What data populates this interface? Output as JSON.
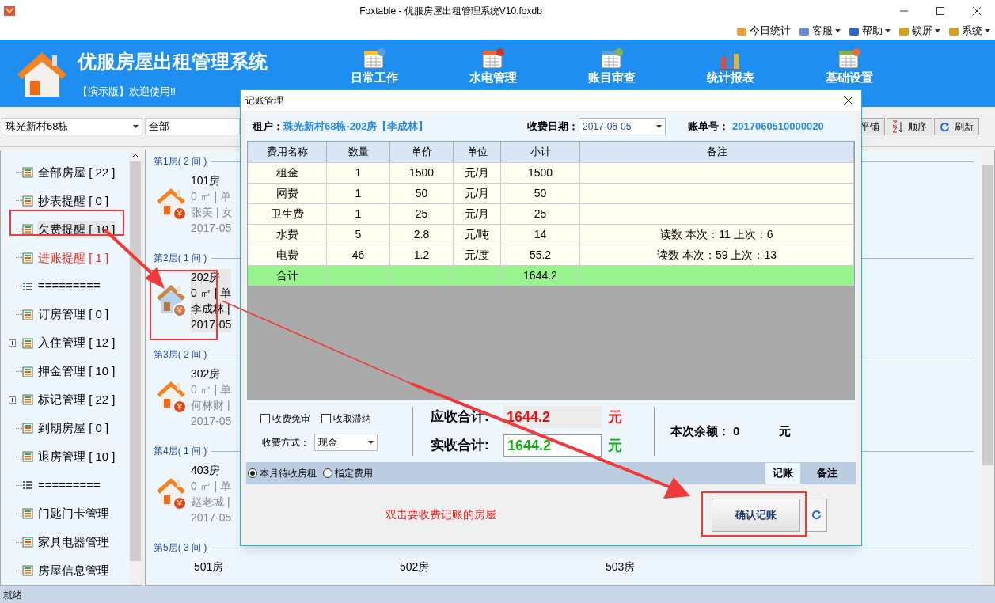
{
  "window": {
    "title": "Foxtable - 优服房屋出租管理系统V10.foxdb"
  },
  "menu": [
    {
      "label": "今日统计",
      "dropdown": false
    },
    {
      "label": "客服",
      "dropdown": true
    },
    {
      "label": "帮助",
      "dropdown": true
    },
    {
      "label": "锁屏",
      "dropdown": true
    },
    {
      "label": "系统",
      "dropdown": true
    }
  ],
  "header": {
    "title": "优服房屋出租管理系统",
    "subtitle": "【演示版】欢迎使用!!",
    "nav": [
      "日常工作",
      "水电管理",
      "账目审查",
      "统计报表",
      "基础设置"
    ]
  },
  "toolbar": {
    "building": "珠光新村68栋",
    "filter": "全部",
    "buttons": [
      "平铺",
      "顺序",
      "刷新"
    ]
  },
  "sidebar": {
    "items": [
      {
        "kind": "item",
        "label": "全部房屋 [ 22 ]",
        "selected": false,
        "alert": false,
        "expandable": false
      },
      {
        "kind": "item",
        "label": "抄表提醒 [ 0 ]",
        "selected": false,
        "alert": false,
        "expandable": false
      },
      {
        "kind": "item",
        "label": "欠费提醒 [ 10 ]",
        "selected": true,
        "alert": false,
        "expandable": false
      },
      {
        "kind": "item",
        "label": "进账提醒 [ 1 ]",
        "selected": false,
        "alert": true,
        "expandable": false
      },
      {
        "kind": "separator",
        "label": "========="
      },
      {
        "kind": "item",
        "label": "订房管理 [ 0 ]",
        "selected": false,
        "alert": false,
        "expandable": false
      },
      {
        "kind": "item",
        "label": "入住管理 [ 12 ]",
        "selected": false,
        "alert": false,
        "expandable": true
      },
      {
        "kind": "item",
        "label": "押金管理 [ 10 ]",
        "selected": false,
        "alert": false,
        "expandable": false
      },
      {
        "kind": "item",
        "label": "标记管理 [ 22 ]",
        "selected": false,
        "alert": false,
        "expandable": true
      },
      {
        "kind": "item",
        "label": "到期房屋 [ 0 ]",
        "selected": false,
        "alert": false,
        "expandable": false
      },
      {
        "kind": "item",
        "label": "退房管理 [ 10 ]",
        "selected": false,
        "alert": false,
        "expandable": false
      },
      {
        "kind": "separator",
        "label": "========="
      },
      {
        "kind": "item",
        "label": "门匙门卡管理",
        "selected": false,
        "alert": false,
        "expandable": false
      },
      {
        "kind": "item",
        "label": "家具电器管理",
        "selected": false,
        "alert": false,
        "expandable": false
      },
      {
        "kind": "item",
        "label": "房屋信息管理",
        "selected": false,
        "alert": false,
        "expandable": false
      }
    ]
  },
  "floors": [
    {
      "label": "第1层( 2 间 )",
      "rooms": [
        {
          "name": "101房",
          "area": "0 ㎡ | 单",
          "tenant": "张美 | 女",
          "date": "2017-05",
          "selected": false
        }
      ]
    },
    {
      "label": "第2层( 1 间 )",
      "rooms": [
        {
          "name": "202房",
          "area": "0 ㎡ | 单",
          "tenant": "李成林 |",
          "date": "2017-05",
          "selected": true
        }
      ]
    },
    {
      "label": "第3层( 2 间 )",
      "rooms": [
        {
          "name": "302房",
          "area": "0 ㎡ | 单",
          "tenant": "何林财 |",
          "date": "2017-05",
          "selected": false
        }
      ]
    },
    {
      "label": "第4层( 1 间 )",
      "rooms": [
        {
          "name": "403房",
          "area": "0 ㎡ | 单",
          "tenant": "赵老城 |",
          "date": "2017-05",
          "selected": false
        }
      ]
    },
    {
      "label": "第5层( 3 间 )",
      "rooms": [
        {
          "name": "501房"
        },
        {
          "name": "502房"
        },
        {
          "name": "503房"
        }
      ]
    }
  ],
  "dialog": {
    "title": "记账管理",
    "tenant_label": "租户：",
    "tenant": "珠光新村68栋-202房【李成林】",
    "date_label": "收费日期：",
    "date": "2017-06-05",
    "bill_label": "账单号：",
    "bill": "2017060510000020",
    "table": {
      "columns": [
        "费用名称",
        "数量",
        "单价",
        "单位",
        "小计",
        "备注"
      ],
      "rows": [
        {
          "kind": "item",
          "cells": [
            "租金",
            "1",
            "1500",
            "元/月",
            "1500",
            ""
          ]
        },
        {
          "kind": "item",
          "cells": [
            "网费",
            "1",
            "50",
            "元/月",
            "50",
            ""
          ]
        },
        {
          "kind": "item",
          "cells": [
            "卫生费",
            "1",
            "25",
            "元/月",
            "25",
            ""
          ]
        },
        {
          "kind": "item",
          "cells": [
            "水费",
            "5",
            "2.8",
            "元/吨",
            "14",
            "读数   本次：11  上次：6"
          ]
        },
        {
          "kind": "item",
          "cells": [
            "电费",
            "46",
            "1.2",
            "元/度",
            "55.2",
            "读数   本次：59  上次：13"
          ]
        },
        {
          "kind": "total",
          "cells": [
            "合计",
            "",
            "",
            "",
            "1644.2",
            ""
          ]
        }
      ]
    },
    "options": [
      {
        "label": "收费免审",
        "checked": false
      },
      {
        "label": "收取滞纳",
        "checked": false
      }
    ],
    "payment_label": "收费方式：",
    "payment": "现金",
    "due_label": "应收合计:",
    "due": "1644.2",
    "due_unit": "元",
    "paid_label": "实收合计:",
    "paid": "1644.2",
    "paid_unit": "元",
    "balance_label": "本次余额：",
    "balance": "0",
    "balance_unit": "元",
    "scope": [
      {
        "label": "本月待收房租",
        "selected": true
      },
      {
        "label": "指定费用",
        "selected": false
      }
    ],
    "tabs": [
      {
        "label": "记账",
        "selected": true
      },
      {
        "label": "备注",
        "selected": false
      }
    ],
    "hint": "双击要收费记账的房屋",
    "confirm": "确认记账"
  },
  "status_bar": {
    "text": "就绪"
  }
}
